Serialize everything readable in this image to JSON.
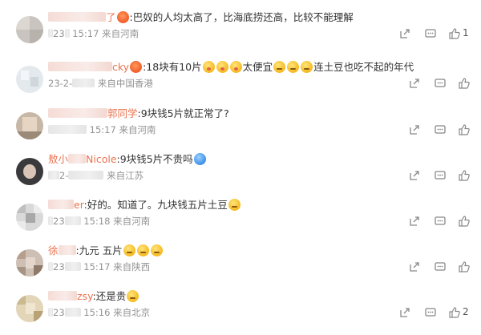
{
  "comments": [
    {
      "name_suffix": "了",
      "emojis_after_name": 1,
      "text": ":巴奴的人均太高了，比海底捞还高，比较不能理解",
      "date_visible": "23",
      "time": "15:17",
      "location": "来自河南",
      "like_count": "1"
    },
    {
      "name_suffix": "cky",
      "emojis_after_name": 1,
      "text_parts": [
        ":18块有10片",
        "太便宜",
        "连土豆也吃不起的年代"
      ],
      "date_visible": "23-2-",
      "time": "",
      "location": "来自中国香港",
      "like_count": ""
    },
    {
      "name_suffix": "郭同学",
      "text": ":9块钱5片就正常了?",
      "date_visible": "",
      "time": "15:17",
      "location": "来自河南",
      "like_count": ""
    },
    {
      "name_prefix": "敖小",
      "name_suffix": "Nicole",
      "text": ":9块钱5片不贵吗",
      "date_visible": "2-",
      "time": "",
      "location": "来自江苏",
      "like_count": ""
    },
    {
      "name_suffix": "er",
      "text": ":好的。知道了。九块钱五片土豆",
      "date_visible": "23",
      "time": "15:18",
      "location": "来自河南",
      "like_count": ""
    },
    {
      "name_prefix": "徐",
      "text": ":九元 五片",
      "date_visible": "23",
      "time": "15:17",
      "location": "来自陕西",
      "like_count": ""
    },
    {
      "name_suffix": "zsy",
      "text": ":还是贵",
      "date_visible": "23",
      "time": "15:16",
      "location": "来自北京",
      "like_count": "2"
    }
  ],
  "icons": [
    "share-icon",
    "comment-icon",
    "like-icon"
  ]
}
